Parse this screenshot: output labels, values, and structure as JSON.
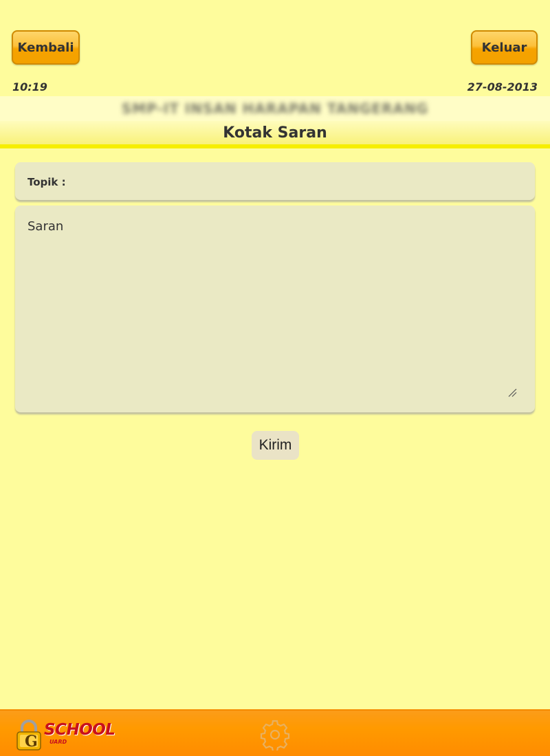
{
  "header": {
    "back_label": "Kembali",
    "logout_label": "Keluar",
    "time": "10:19",
    "date": "27-08-2013",
    "school_name": "SMP-IT INSAN HARAPAN TANGERANG",
    "page_title": "Kotak Saran"
  },
  "form": {
    "topic_label": "Topik :",
    "topic_value": "",
    "suggestion_placeholder": "Saran",
    "submit_label": "Kirim"
  },
  "footer": {
    "logo_text": "SCHOOL",
    "logo_letter": "G",
    "logo_sub": "UARD",
    "settings_icon": "gear-icon"
  },
  "colors": {
    "background": "#fefc9c",
    "button_orange": "#fcc03a",
    "footer_orange": "#ff9a00",
    "field_bg": "#eae9c4",
    "title_underline": "#f6ee00",
    "logo_red": "#c8101c"
  }
}
